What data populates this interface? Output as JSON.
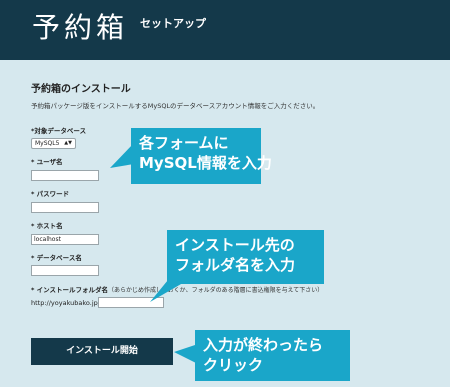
{
  "header": {
    "logo": "予約箱",
    "subtitle": "セットアップ"
  },
  "section": {
    "title": "予約箱のインストール",
    "description": "予約箱パッケージ版をインストールするMySQLのデータベースアカウント情報をご入力ください。"
  },
  "form": {
    "db_type": {
      "label": "*対象データベース",
      "selected": "MySQL5"
    },
    "user": {
      "label": "* ユーザ名",
      "value": ""
    },
    "password": {
      "label": "* パスワード",
      "value": ""
    },
    "host": {
      "label": "* ホスト名",
      "value": "localhost"
    },
    "database": {
      "label": "* データベース名",
      "value": ""
    },
    "folder": {
      "label": "* インストールフォルダ名",
      "note": "（あらかじめ作成しておくか、フォルダのある階層に書込権限を与えて下さい）",
      "prefix": "http://yoyakubako.jp/",
      "value": ""
    },
    "install_button": "インストール開始"
  },
  "callouts": {
    "c1": [
      "各フォームに",
      "MySQL情報を入力"
    ],
    "c2": [
      "インストール先の",
      "フォルダ名を入力"
    ],
    "c3": [
      "入力が終わったら",
      "クリック"
    ]
  },
  "colors": {
    "header_bg": "#14394a",
    "callout_bg": "#1aa6c9",
    "page_bg": "#d6e8ee"
  }
}
